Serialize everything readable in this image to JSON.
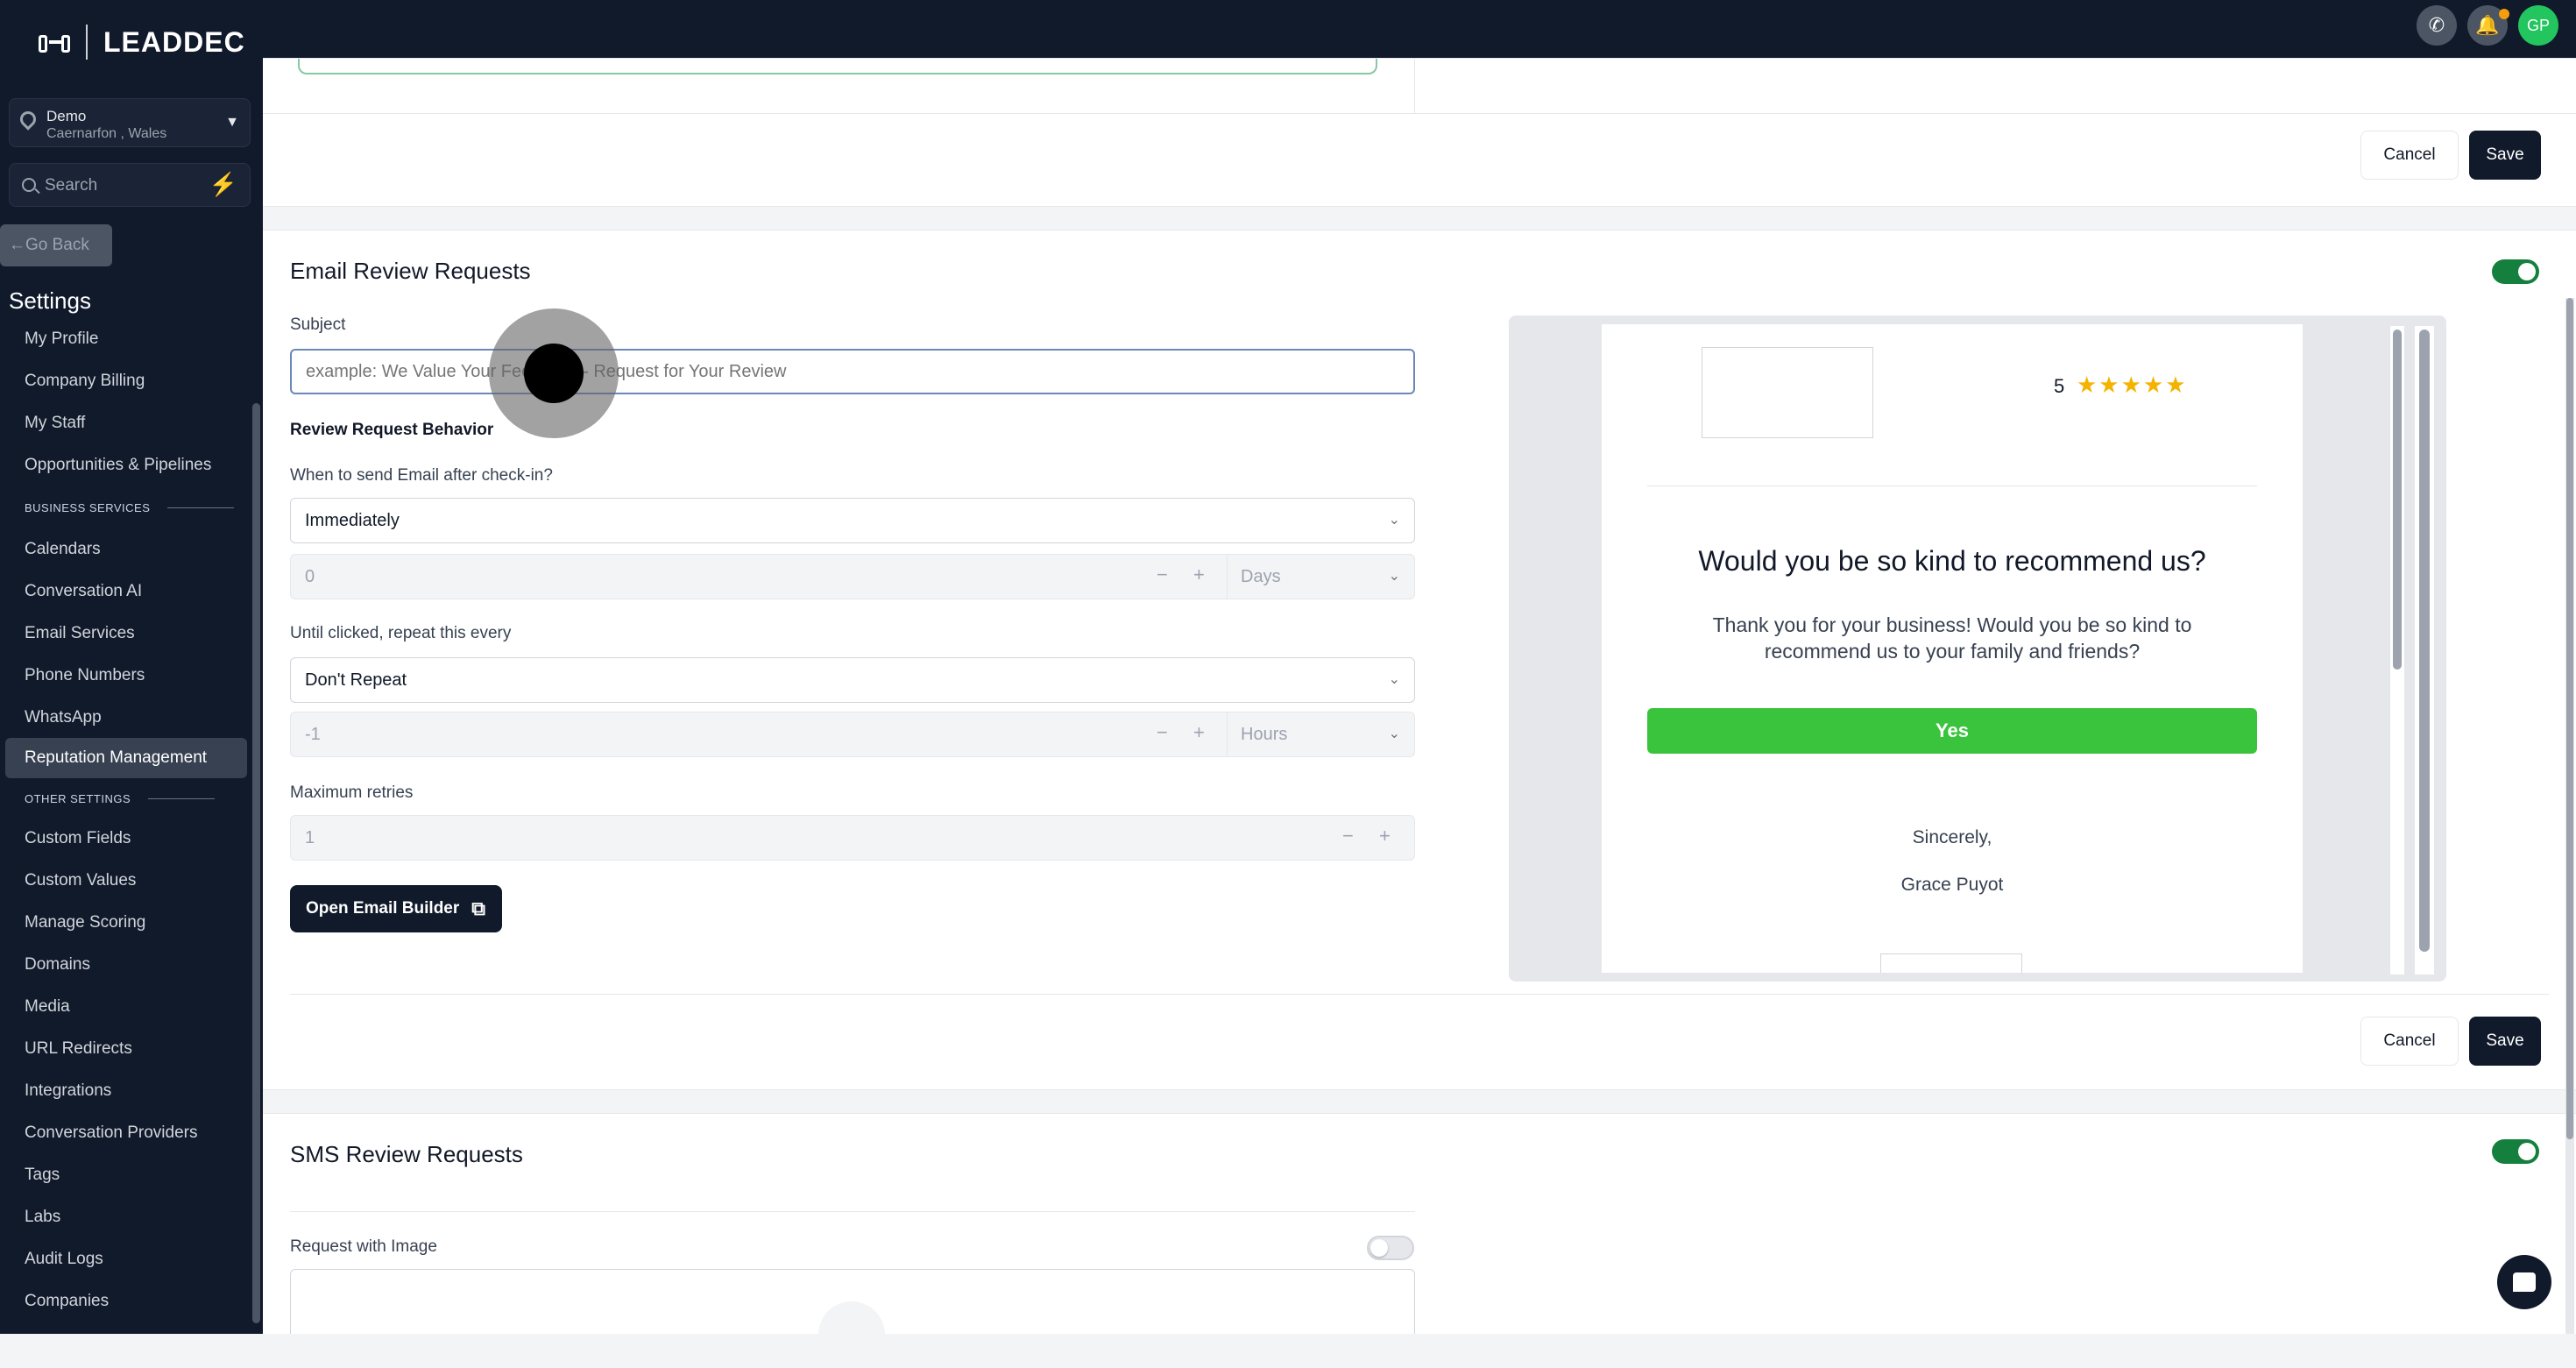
{
  "sidebar": {
    "logo_text": "LEADDEC",
    "location": {
      "name": "Demo",
      "address": "Caernarfon , Wales"
    },
    "search_placeholder": "Search",
    "go_back": "Go Back",
    "settings_heading": "Settings",
    "items_top": [
      "My Profile",
      "Company Billing",
      "My Staff",
      "Opportunities & Pipelines"
    ],
    "section_business": "BUSINESS SERVICES",
    "items_business": [
      "Calendars",
      "Conversation AI",
      "Email Services",
      "Phone Numbers",
      "WhatsApp",
      "Reputation Management"
    ],
    "section_other": "OTHER SETTINGS",
    "items_other": [
      "Custom Fields",
      "Custom Values",
      "Manage Scoring",
      "Domains",
      "Media",
      "URL Redirects",
      "Integrations",
      "Conversation Providers",
      "Tags",
      "Labs",
      "Audit Logs",
      "Companies"
    ]
  },
  "topbar": {
    "avatar_initials": "GP"
  },
  "buttons": {
    "cancel": "Cancel",
    "save": "Save"
  },
  "email_section": {
    "title": "Email Review Requests",
    "subject_label": "Subject",
    "subject_placeholder": "example: We Value Your Feedback - Request for Your Review",
    "behavior_heading": "Review Request Behavior",
    "when_label": "When to send Email after check-in?",
    "when_value": "Immediately",
    "delay_value": "0",
    "delay_unit": "Days",
    "repeat_label": "Until clicked, repeat this every",
    "repeat_value": "Don't Repeat",
    "repeat_amount": "-1",
    "repeat_unit": "Hours",
    "retries_label": "Maximum retries",
    "retries_value": "1",
    "open_builder": "Open Email Builder",
    "enabled": true
  },
  "preview": {
    "rating": "5",
    "stars": "★★★★★",
    "heading": "Would you be so kind to recommend us?",
    "body_line1": "Thank you for your business! Would you be so kind to",
    "body_line2": "recommend us to your family and friends?",
    "yes_button": "Yes",
    "closing": "Sincerely,",
    "signature": "Grace Puyot"
  },
  "sms_section": {
    "title": "SMS Review Requests",
    "request_with_image_label": "Request with Image",
    "enabled": true,
    "image_enabled": false
  },
  "colors": {
    "toggle_on": "#15803d",
    "yes_button": "#3ac43d",
    "sidebar_bg": "#111a2b",
    "star": "#f5b301"
  }
}
